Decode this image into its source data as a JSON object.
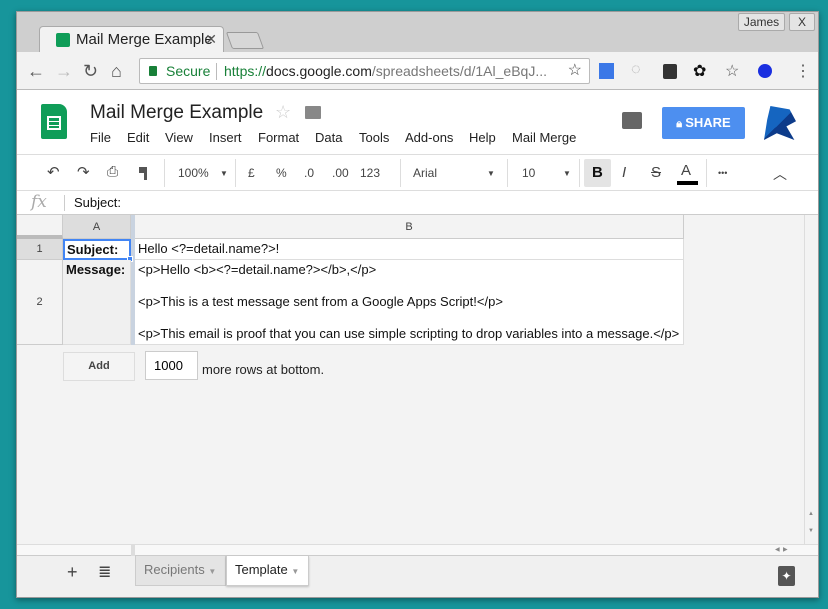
{
  "browser": {
    "profile": "James",
    "close": "X",
    "tab_title": "Mail Merge Example",
    "secure_label": "Secure",
    "url_scheme": "https://",
    "url_host": "docs.google.com",
    "url_path": "/spreadsheets/d/1Al_eBqJ..."
  },
  "app": {
    "doc_title": "Mail Merge Example",
    "share_label": "SHARE",
    "menu": [
      "File",
      "Edit",
      "View",
      "Insert",
      "Format",
      "Data",
      "Tools",
      "Add-ons",
      "Help",
      "Mail Merge"
    ]
  },
  "toolbar": {
    "zoom": "100%",
    "currency": "£",
    "percent": "%",
    "dec_less": ".0",
    "dec_more": ".00",
    "more_formats": "123",
    "font": "Arial",
    "font_size": "10",
    "bold": "B",
    "italic": "I",
    "strike": "S",
    "text_color": "A",
    "more": "•••"
  },
  "formula_bar": {
    "fx": "fx",
    "value": "Subject:"
  },
  "grid": {
    "columns": [
      "A",
      "B"
    ],
    "rows": [
      {
        "num": "1",
        "a": "Subject:",
        "b": [
          "Hello <?=detail.name?>!"
        ]
      },
      {
        "num": "2",
        "a": "Message:",
        "b": [
          "<p>Hello <b><?=detail.name?></b>,</p>",
          "<p>This is a test message sent from a Google Apps Script!</p>",
          "<p>This email is proof that you can use simple scripting to drop variables into a message.</p>"
        ]
      }
    ]
  },
  "add_rows": {
    "button": "Add",
    "count": "1000",
    "suffix": "more rows at bottom."
  },
  "sheets": [
    {
      "name": "Recipients",
      "active": false
    },
    {
      "name": "Template",
      "active": true
    }
  ],
  "colors": {
    "share": "#4d8ff0",
    "sheets_green": "#0f9d58",
    "selection": "#4285f4"
  }
}
